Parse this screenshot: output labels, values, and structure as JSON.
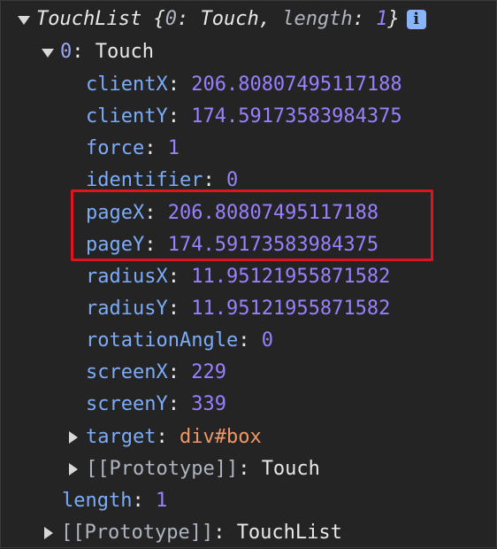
{
  "root": {
    "title": "TouchList",
    "preview_open": "{",
    "preview_index": "0",
    "preview_index_value": "Touch",
    "preview_length_key": "length",
    "preview_length_value": "1",
    "preview_close": "}",
    "info_icon_label": "i"
  },
  "touch": {
    "index": "0",
    "class_name": "Touch",
    "properties": [
      {
        "key": "clientX",
        "value": "206.80807495117188"
      },
      {
        "key": "clientY",
        "value": "174.59173583984375"
      },
      {
        "key": "force",
        "value": "1"
      },
      {
        "key": "identifier",
        "value": "0"
      },
      {
        "key": "pageX",
        "value": "206.80807495117188"
      },
      {
        "key": "pageY",
        "value": "174.59173583984375"
      },
      {
        "key": "radiusX",
        "value": "11.95121955871582"
      },
      {
        "key": "radiusY",
        "value": "11.95121955871582"
      },
      {
        "key": "rotationAngle",
        "value": "0"
      },
      {
        "key": "screenX",
        "value": "229"
      },
      {
        "key": "screenY",
        "value": "339"
      }
    ],
    "target_key": "target",
    "target_value": "div#box",
    "prototype_key": "[[Prototype]]",
    "prototype_value": "Touch"
  },
  "list_length": {
    "key": "length",
    "value": "1"
  },
  "list_prototype": {
    "key": "[[Prototype]]",
    "value": "TouchList"
  },
  "colors": {
    "background": "#242424",
    "key": "#7cacf8",
    "number": "#9980ff",
    "node": "#f29766",
    "highlight": "#e0141e"
  }
}
